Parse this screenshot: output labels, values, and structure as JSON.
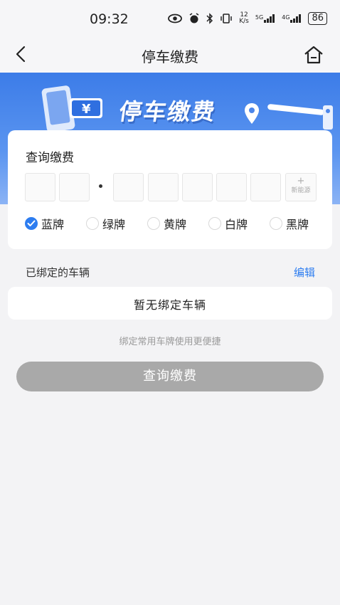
{
  "status_bar": {
    "time": "09:32",
    "net_speed_value": "12",
    "net_speed_unit": "K/s",
    "sim1": "5G",
    "sim2": "4G",
    "battery": "86"
  },
  "nav": {
    "title": "停车缴费"
  },
  "banner": {
    "title": "停车缴费",
    "currency_symbol": "¥"
  },
  "query_card": {
    "title": "查询缴费",
    "new_energy_plus": "+",
    "new_energy_label": "新能源",
    "plate_colors": [
      {
        "label": "蓝牌",
        "checked": true
      },
      {
        "label": "绿牌",
        "checked": false
      },
      {
        "label": "黄牌",
        "checked": false
      },
      {
        "label": "白牌",
        "checked": false
      },
      {
        "label": "黑牌",
        "checked": false
      }
    ]
  },
  "bound": {
    "label": "已绑定的车辆",
    "edit": "编辑",
    "empty": "暂无绑定车辆",
    "hint": "绑定常用车牌使用更便捷"
  },
  "submit": {
    "label": "查询缴费"
  },
  "colors": {
    "accent": "#2d7df0",
    "banner": "#3c7ce8",
    "button_disabled": "#a9a9a9"
  }
}
